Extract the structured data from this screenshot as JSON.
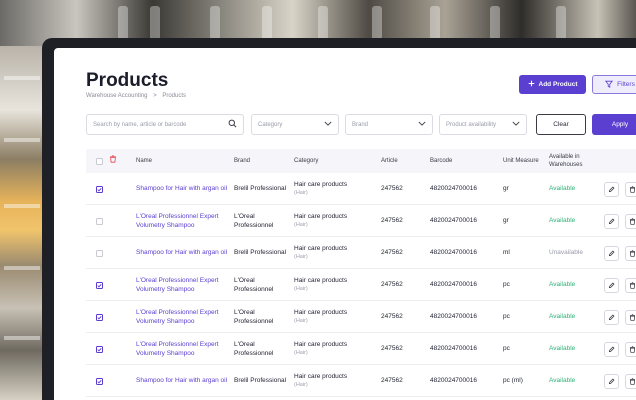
{
  "page": {
    "title": "Products",
    "breadcrumb": [
      "Warehouse Accounting",
      ">",
      "Products"
    ]
  },
  "actions": {
    "add_label": "Add Product",
    "filters_label": "Filters"
  },
  "filters": {
    "search_placeholder": "Search by name, article or barcode",
    "category": "Category",
    "brand": "Brand",
    "availability": "Product availability",
    "clear_label": "Clear",
    "apply_label": "Apply"
  },
  "table": {
    "columns": [
      "Name",
      "Brand",
      "Category",
      "Article",
      "Barcode",
      "Unit Measure",
      "Available in Warehouses"
    ],
    "rows": [
      {
        "checked": true,
        "name": "Shampoo for Hair with argan oil",
        "brand": "Brelil Professional",
        "category": "Hair care products",
        "category_sub": "(Hair)",
        "article": "247562",
        "barcode": "4820024700016",
        "unit": "gr",
        "availability": "Available"
      },
      {
        "checked": false,
        "name": "L'Oreal Professionnel Expert Volumetry Shampoo",
        "brand": "L'Oreal Professionnel",
        "category": "Hair care products",
        "category_sub": "(Hair)",
        "article": "247562",
        "barcode": "4820024700016",
        "unit": "gr",
        "availability": "Available"
      },
      {
        "checked": false,
        "name": "Shampoo for Hair with argan oil",
        "brand": "Brelil Professional",
        "category": "Hair care products",
        "category_sub": "(Hair)",
        "article": "247562",
        "barcode": "4820024700016",
        "unit": "ml",
        "availability": "Unavailable"
      },
      {
        "checked": true,
        "name": "L'Oreal Professionnel Expert Volumetry Shampoo",
        "brand": "L'Oreal Professionnel",
        "category": "Hair care products",
        "category_sub": "(Hair)",
        "article": "247562",
        "barcode": "4820024700016",
        "unit": "pc",
        "availability": "Available"
      },
      {
        "checked": true,
        "name": "L'Oreal Professionnel Expert Volumetry Shampoo",
        "brand": "L'Oreal Professionnel",
        "category": "Hair care products",
        "category_sub": "(Hair)",
        "article": "247562",
        "barcode": "4820024700016",
        "unit": "pc",
        "availability": "Available"
      },
      {
        "checked": true,
        "name": "L'Oreal Professionnel Expert Volumetry Shampoo",
        "brand": "L'Oreal Professionnel",
        "category": "Hair care products",
        "category_sub": "(Hair)",
        "article": "247562",
        "barcode": "4820024700016",
        "unit": "pc",
        "availability": "Available"
      },
      {
        "checked": true,
        "name": "Shampoo for Hair with argan oil",
        "brand": "Brelil Professional",
        "category": "Hair care products",
        "category_sub": "(Hair)",
        "article": "247562",
        "barcode": "4820024700016",
        "unit": "pc (ml)",
        "availability": "Available"
      }
    ]
  },
  "colors": {
    "accent": "#5b3fd0",
    "available": "#2fb07a",
    "unavailable": "#9a9ca8",
    "delete": "#e2454f"
  },
  "icons": {
    "search": "search-icon",
    "chevron": "chevron-down-icon",
    "plus": "plus-icon",
    "filter": "filter-icon",
    "trash": "trash-icon",
    "edit": "pencil-icon",
    "check": "check-icon"
  }
}
